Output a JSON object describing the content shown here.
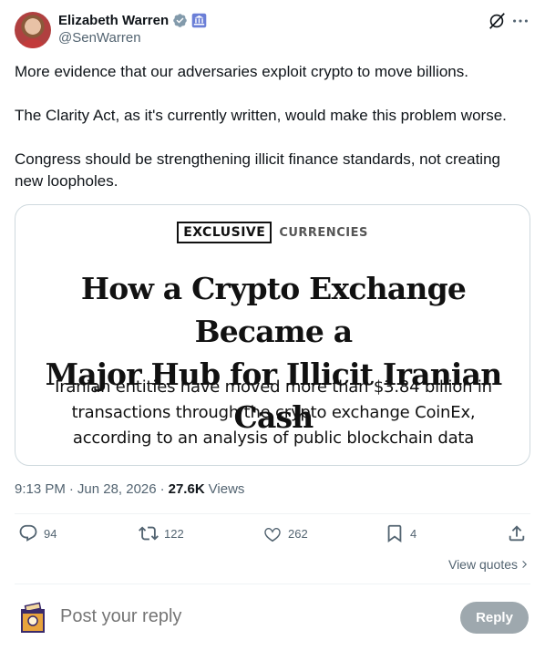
{
  "author": {
    "display_name": "Elizabeth Warren",
    "handle": "@SenWarren",
    "avatar_icon": "avatar",
    "verified_icon": "verified-badge-icon",
    "affiliation_icon": "government-badge-icon"
  },
  "tweet": {
    "paragraphs": [
      "More evidence that our adversaries exploit crypto to move billions.",
      "The Clarity Act, as it's currently written, would make this problem worse.",
      "Congress should be strengthening illicit finance standards, not creating new loopholes."
    ]
  },
  "card": {
    "kicker_exclusive": "EXCLUSIVE",
    "kicker_section": "CURRENCIES",
    "headline_line1": "How a Crypto Exchange Became a",
    "headline_line2": "Major Hub for Illicit Iranian Cash",
    "dek_line1": "Iranian entities have moved more than $3.84 billion in",
    "dek_line2": "transactions through the crypto exchange CoinEx,",
    "dek_line3": "according to an analysis of public blockchain data"
  },
  "meta": {
    "time": "9:13 PM",
    "sep1": "·",
    "date": "Jun 28, 2026",
    "sep2": "·",
    "views_count": "27.6K",
    "views_label": "Views"
  },
  "actions": {
    "replies": "94",
    "reposts": "122",
    "likes": "262",
    "bookmarks": "4"
  },
  "view_quotes": "View quotes",
  "reply": {
    "placeholder": "Post your reply",
    "button_label": "Reply"
  },
  "colors": {
    "text_primary": "#0f1419",
    "text_secondary": "#536471",
    "border": "#cfd9de",
    "verified": "#829aab",
    "reply_button": "#8e9aa0"
  }
}
